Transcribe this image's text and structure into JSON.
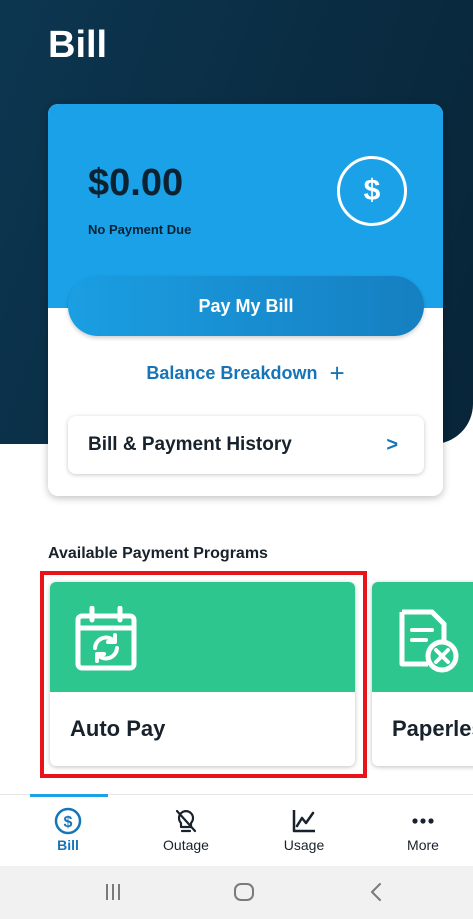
{
  "page": {
    "title": "Bill"
  },
  "bill_card": {
    "amount": "$0.00",
    "status": "No Payment Due",
    "pay_button": "Pay My Bill",
    "balance_breakdown": "Balance Breakdown",
    "balance_breakdown_icon": "+",
    "history_label": "Bill & Payment History",
    "history_chevron": ">"
  },
  "programs": {
    "title": "Available Payment Programs",
    "items": [
      {
        "label": "Auto Pay",
        "icon": "calendar-sync-icon"
      },
      {
        "label": "Paperless",
        "icon": "document-x-icon"
      }
    ]
  },
  "bottom_nav": {
    "items": [
      {
        "label": "Bill",
        "icon": "dollar-circle-icon",
        "active": true
      },
      {
        "label": "Outage",
        "icon": "lightbulb-off-icon"
      },
      {
        "label": "Usage",
        "icon": "line-chart-icon"
      },
      {
        "label": "More",
        "icon": "more-dots-icon"
      }
    ]
  },
  "colors": {
    "header_bg": "#0c3650",
    "card_blue": "#1ba1e8",
    "accent_blue": "#1675b8",
    "program_green": "#2ec68f",
    "highlight_red": "#e8141b"
  }
}
